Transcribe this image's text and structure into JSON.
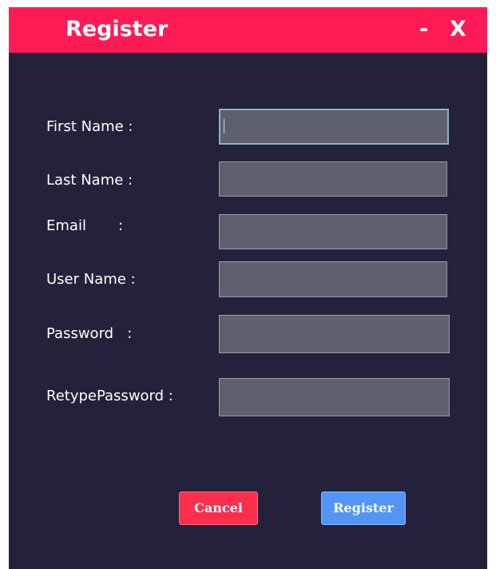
{
  "window": {
    "title": "Register",
    "minimize_label": "-",
    "close_label": "X"
  },
  "form": {
    "fields": [
      {
        "label": "First Name :",
        "value": "",
        "focused": true
      },
      {
        "label": "Last Name :",
        "value": ""
      },
      {
        "label": "Email       :",
        "value": ""
      },
      {
        "label": "User Name :",
        "value": ""
      },
      {
        "label": "Password   :",
        "value": ""
      },
      {
        "label": "RetypePassword :",
        "value": ""
      }
    ]
  },
  "buttons": {
    "cancel_label": "Cancel",
    "register_label": "Register"
  },
  "colors": {
    "titlebar": "#fe1b55",
    "background": "#23223a",
    "input_bg": "#5e606e",
    "cancel": "#fb2e4d",
    "register": "#5395f7"
  }
}
